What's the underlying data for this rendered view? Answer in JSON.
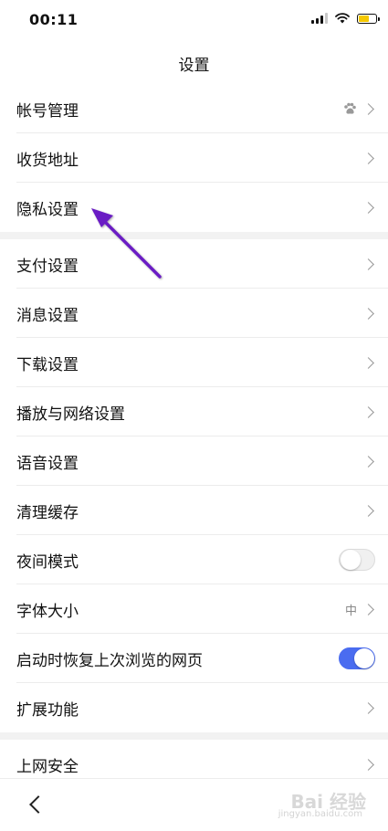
{
  "status_bar": {
    "time": "00:11",
    "battery_color": "#f5c800"
  },
  "page": {
    "title": "设置"
  },
  "sections": [
    {
      "items": [
        {
          "label": "帐号管理",
          "right": "paw",
          "icon": "paw-icon"
        },
        {
          "label": "收货地址"
        },
        {
          "label": "隐私设置"
        }
      ]
    },
    {
      "items": [
        {
          "label": "支付设置"
        },
        {
          "label": "消息设置"
        },
        {
          "label": "下载设置"
        },
        {
          "label": "播放与网络设置"
        },
        {
          "label": "语音设置"
        },
        {
          "label": "清理缓存"
        },
        {
          "label": "夜间模式",
          "toggle": "off"
        },
        {
          "label": "字体大小",
          "value": "中"
        },
        {
          "label": "启动时恢复上次浏览的网页",
          "toggle": "on"
        },
        {
          "label": "扩展功能"
        }
      ]
    },
    {
      "items": [
        {
          "label": "上网安全"
        }
      ]
    }
  ],
  "colors": {
    "toggle_on": "#4a6cf0",
    "annotation_arrow": "#6a1fc4"
  },
  "watermark": {
    "text": "Bai 经验",
    "sub": "jingyan.baidu.com"
  }
}
